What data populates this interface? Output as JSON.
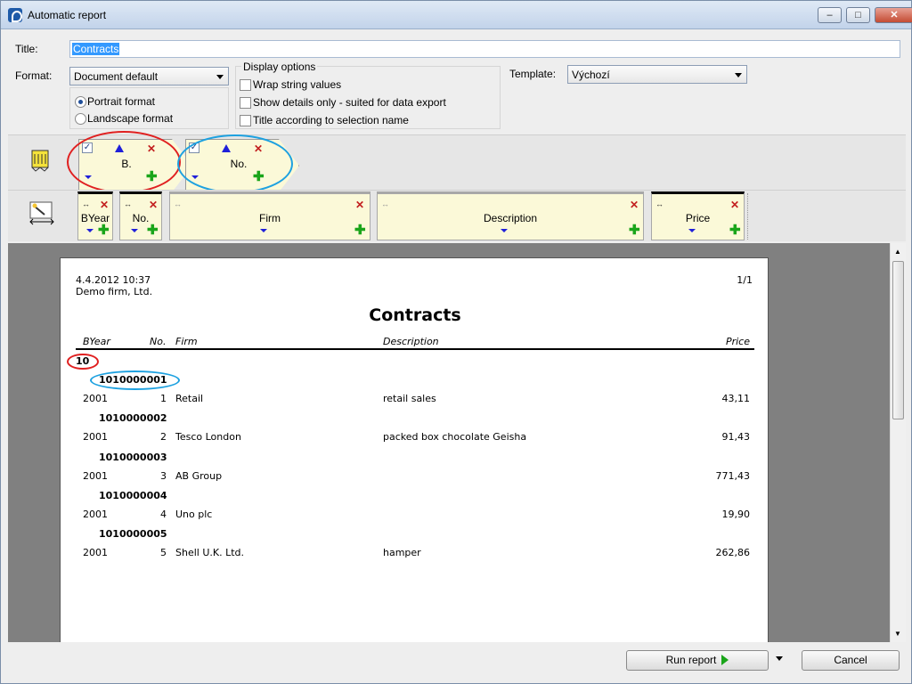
{
  "window": {
    "title": "Automatic report",
    "minimize_icon": "minimize-icon",
    "maximize_icon": "maximize-icon",
    "close_icon": "close-icon"
  },
  "settings": {
    "title_label": "Title:",
    "title_value": "Contracts",
    "format_label": "Format:",
    "format_value": "Document default",
    "portrait_label": "Portrait format",
    "landscape_label": "Landscape format",
    "portrait_selected": true,
    "display_options_label": "Display options",
    "wrap_strings_label": "Wrap string values",
    "show_details_label": "Show details only - suited for data export",
    "title_by_selection_label": "Title according to selection name",
    "template_label": "Template:",
    "template_value": "Výchozí"
  },
  "grouping": {
    "icon": "grouping-icon",
    "chips": [
      {
        "label": "B.",
        "checked": true,
        "highlight": "#e02020"
      },
      {
        "label": "No.",
        "checked": true,
        "highlight": "#1da1e0"
      }
    ]
  },
  "columns": {
    "icon": "column-editor-icon",
    "items": [
      {
        "label": "BYear"
      },
      {
        "label": "No."
      },
      {
        "label": "Firm"
      },
      {
        "label": "Description"
      },
      {
        "label": "Price"
      }
    ]
  },
  "report": {
    "datetime": "4.4.2012 10:37",
    "company": "Demo firm, Ltd.",
    "page": "1/1",
    "title": "Contracts",
    "headers": {
      "byear": "BYear",
      "no": "No.",
      "firm": "Firm",
      "description": "Description",
      "price": "Price"
    },
    "group1": "10",
    "records": [
      {
        "group": "1010000001",
        "byear": "2001",
        "no": "1",
        "firm": "Retail",
        "description": "retail sales",
        "price": "43,11"
      },
      {
        "group": "1010000002",
        "byear": "2001",
        "no": "2",
        "firm": "Tesco London",
        "description": "packed box chocolate Geisha",
        "price": "91,43"
      },
      {
        "group": "1010000003",
        "byear": "2001",
        "no": "3",
        "firm": "AB Group",
        "description": "",
        "price": "771,43"
      },
      {
        "group": "1010000004",
        "byear": "2001",
        "no": "4",
        "firm": "Uno plc",
        "description": "",
        "price": "19,90"
      },
      {
        "group": "1010000005",
        "byear": "2001",
        "no": "5",
        "firm": "Shell U.K. Ltd.",
        "description": "hamper",
        "price": "262,86"
      }
    ]
  },
  "footer": {
    "run_label": "Run report",
    "cancel_label": "Cancel"
  },
  "colors": {
    "chip_bg": "#fbf9d8",
    "selection": "#3399ff",
    "preview_bg": "#808080"
  }
}
